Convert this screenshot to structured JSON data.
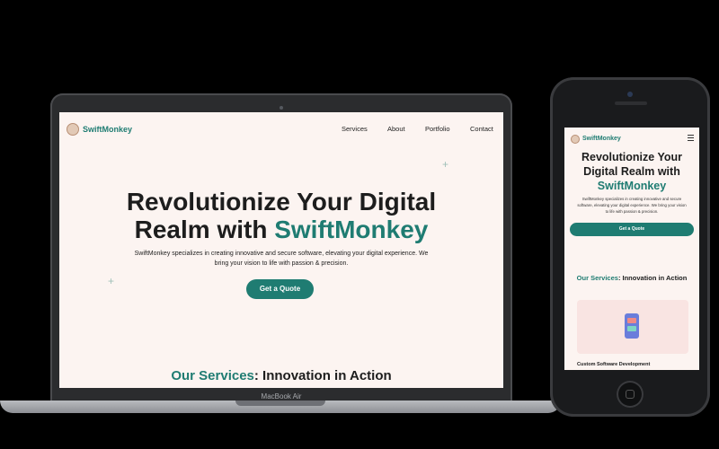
{
  "laptop": {
    "model_label": "MacBook Air",
    "site": {
      "brand": "SwiftMonkey",
      "nav": [
        "Services",
        "About",
        "Portfolio",
        "Contact"
      ],
      "hero_title_line1": "Revolutionize Your Digital",
      "hero_title_line2_prefix": "Realm with ",
      "hero_title_accent": "SwiftMonkey",
      "hero_desc_line1": "SwiftMonkey specializes in creating innovative and secure software, elevating your digital experience. We",
      "hero_desc_line2": "bring your vision to life with passion & precision.",
      "cta": "Get a Quote",
      "services_accent": "Our Services",
      "services_rest": ": Innovation in Action"
    }
  },
  "phone": {
    "site": {
      "brand": "SwiftMonkey",
      "hero_title_line1": "Revolutionize Your",
      "hero_title_line2": "Digital Realm with",
      "hero_title_accent": "SwiftMonkey",
      "hero_desc_line1": "SwiftMonkey specializes in creating innovative and secure",
      "hero_desc_line2": "software, elevating your digital experience. We bring your vision",
      "hero_desc_line3": "to life with passion & precision.",
      "cta": "Get a Quote",
      "services_accent": "Our Services",
      "services_rest": ": Innovation in Action",
      "card_title": "Custom Software Development"
    }
  },
  "colors": {
    "accent": "#1f7c72",
    "page_bg": "#fcf4f1",
    "card_bg": "#f9e4e2"
  },
  "icons": [
    "logo-icon",
    "hamburger-menu-icon",
    "sparkle-icon",
    "mobile-app-illustration"
  ]
}
